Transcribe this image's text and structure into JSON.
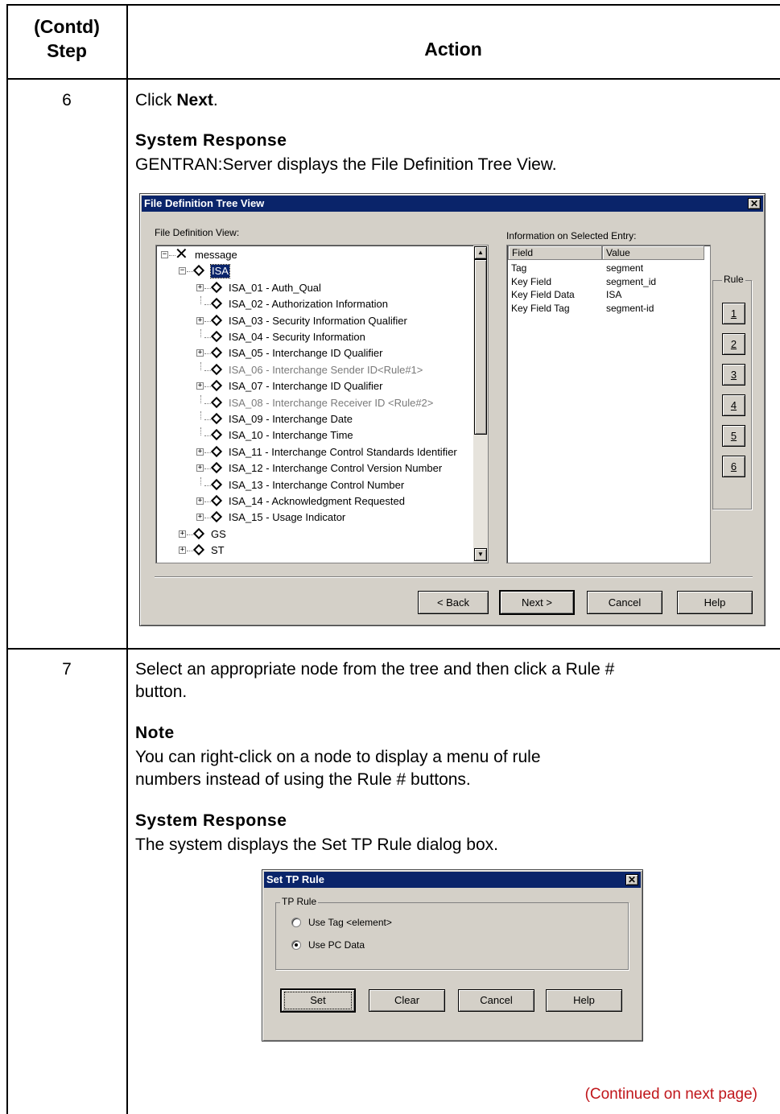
{
  "header": {
    "step_label": "(Contd)\nStep",
    "action_label": "Action"
  },
  "step6": {
    "number": "6",
    "instruction_prefix": "Click ",
    "instruction_bold": "Next",
    "instruction_suffix": ".",
    "response_heading": "System Response",
    "response_text": "GENTRAN:Server displays the File Definition Tree View."
  },
  "tree_dialog": {
    "title": "File Definition Tree View",
    "close_glyph": "✕",
    "left_label": "File Definition View:",
    "right_label": "Information on Selected Entry:",
    "tree": [
      {
        "text": "message",
        "icon": "x-icon",
        "selected": false,
        "gray": false
      },
      {
        "text": "ISA",
        "icon": "diamond-icon",
        "selected": true,
        "gray": false
      },
      {
        "text": "ISA_01 - Auth_Qual",
        "icon": "diamond-icon",
        "selected": false,
        "gray": false
      },
      {
        "text": "ISA_02 - Authorization Information",
        "icon": "diamond-icon",
        "selected": false,
        "gray": false
      },
      {
        "text": "ISA_03 - Security Information Qualifier",
        "icon": "diamond-icon",
        "selected": false,
        "gray": false
      },
      {
        "text": "ISA_04 - Security Information",
        "icon": "diamond-icon",
        "selected": false,
        "gray": false
      },
      {
        "text": "ISA_05 - Interchange ID Qualifier",
        "icon": "diamond-icon",
        "selected": false,
        "gray": false
      },
      {
        "text": "ISA_06 - Interchange Sender ID<Rule#1>",
        "icon": "diamond-icon",
        "selected": false,
        "gray": true
      },
      {
        "text": "ISA_07 - Interchange ID Qualifier",
        "icon": "diamond-icon",
        "selected": false,
        "gray": false
      },
      {
        "text": "ISA_08 - Interchange Receiver ID <Rule#2>",
        "icon": "diamond-icon",
        "selected": false,
        "gray": true
      },
      {
        "text": "ISA_09 - Interchange Date",
        "icon": "diamond-icon",
        "selected": false,
        "gray": false
      },
      {
        "text": "ISA_10 - Interchange Time",
        "icon": "diamond-icon",
        "selected": false,
        "gray": false
      },
      {
        "text": "ISA_11 - Interchange Control Standards Identifier",
        "icon": "diamond-icon",
        "selected": false,
        "gray": false
      },
      {
        "text": "ISA_12 - Interchange Control Version Number",
        "icon": "diamond-icon",
        "selected": false,
        "gray": false
      },
      {
        "text": "ISA_13 - Interchange Control Number",
        "icon": "diamond-icon",
        "selected": false,
        "gray": false
      },
      {
        "text": "ISA_14 - Acknowledgment Requested",
        "icon": "diamond-icon",
        "selected": false,
        "gray": false
      },
      {
        "text": "ISA_15 - Usage Indicator",
        "icon": "diamond-icon",
        "selected": false,
        "gray": false
      },
      {
        "text": "GS",
        "icon": "diamond-icon",
        "selected": false,
        "gray": false
      },
      {
        "text": "ST",
        "icon": "diamond-icon",
        "selected": false,
        "gray": false
      }
    ],
    "info_columns": [
      "Field",
      "Value"
    ],
    "info_rows": [
      {
        "field": "Tag",
        "value": "segment"
      },
      {
        "field": "Key Field",
        "value": "segment_id"
      },
      {
        "field": "Key Field Data",
        "value": "ISA"
      },
      {
        "field": "Key Field Tag",
        "value": "segment-id"
      }
    ],
    "rule_label": "Rule",
    "rule_buttons": [
      "1",
      "2",
      "3",
      "4",
      "5",
      "6"
    ],
    "buttons": {
      "back": "< Back",
      "next": "Next >",
      "cancel": "Cancel",
      "help": "Help"
    }
  },
  "step7": {
    "number": "7",
    "instruction": "Select an appropriate node from the tree and then click a Rule #\nbutton.",
    "note_heading": "Note",
    "note_text": "You can right-click on a node to display a menu of rule\nnumbers instead of using the Rule # buttons.",
    "response_heading": "System Response",
    "response_text": "The system displays the Set TP Rule dialog box."
  },
  "rule_dialog": {
    "title": "Set TP Rule",
    "close_glyph": "✕",
    "group_label": "TP Rule",
    "options": [
      {
        "label": "Use Tag <element>",
        "checked": false
      },
      {
        "label": "Use PC Data",
        "checked": true
      }
    ],
    "buttons": {
      "set": "Set",
      "clear": "Clear",
      "cancel": "Cancel",
      "help": "Help"
    }
  },
  "footer": {
    "continued": "(Continued on next page)"
  },
  "colors": {
    "title_bar": "#0a246a",
    "dialog_face": "#d4d0c8",
    "continued_text": "#c0161b"
  }
}
